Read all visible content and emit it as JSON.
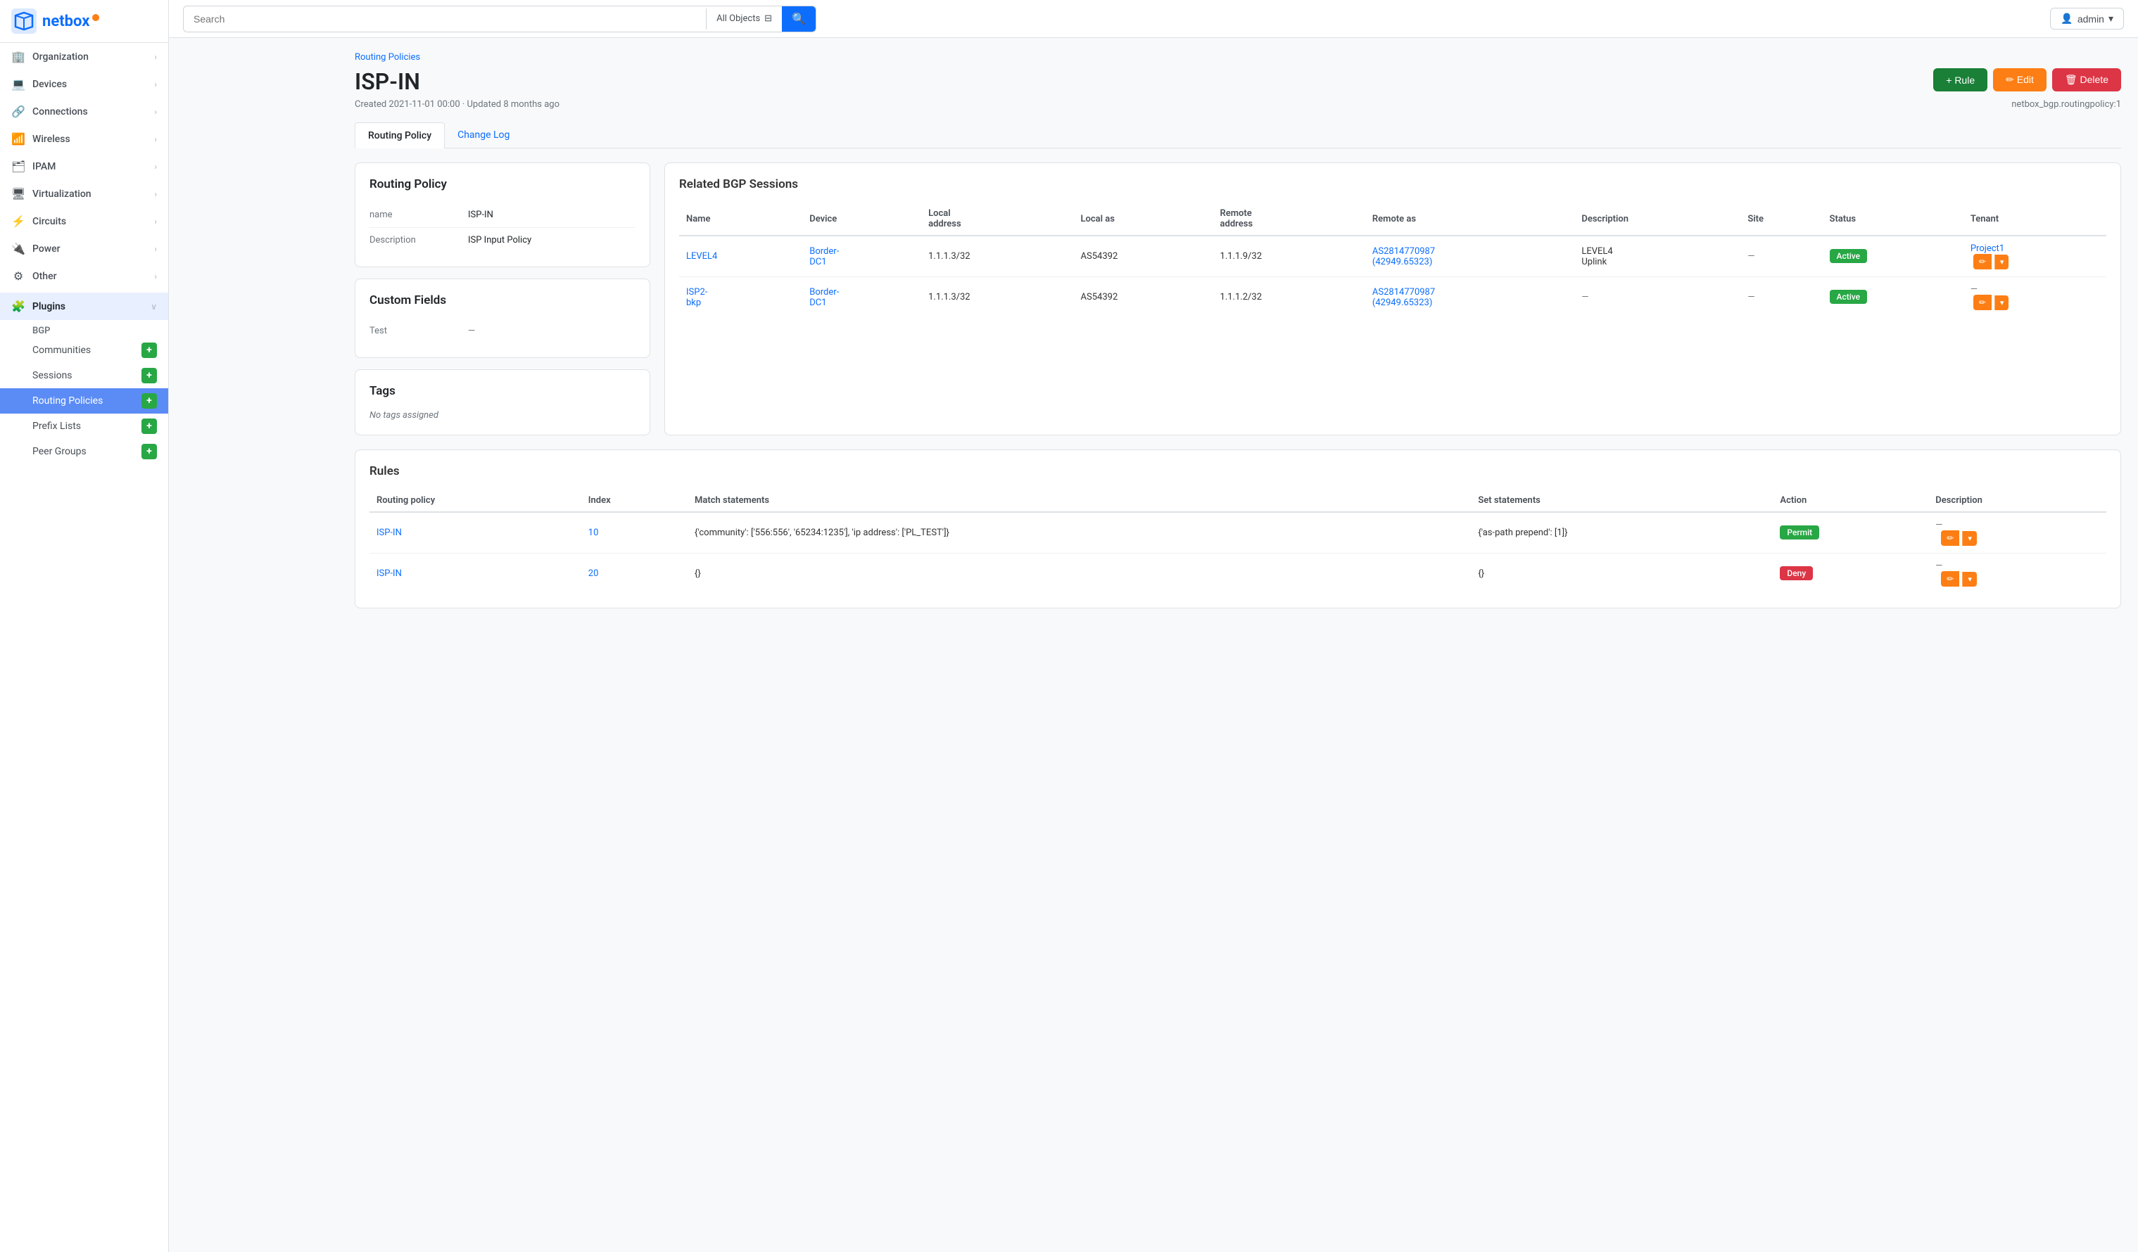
{
  "sidebar": {
    "logo_text": "netbox",
    "nav_items": [
      {
        "id": "organization",
        "label": "Organization",
        "icon": "🏢"
      },
      {
        "id": "devices",
        "label": "Devices",
        "icon": "💻"
      },
      {
        "id": "connections",
        "label": "Connections",
        "icon": "🔗"
      },
      {
        "id": "wireless",
        "label": "Wireless",
        "icon": "📶"
      },
      {
        "id": "ipam",
        "label": "IPAM",
        "icon": "🗂"
      },
      {
        "id": "virtualization",
        "label": "Virtualization",
        "icon": "🖥"
      },
      {
        "id": "circuits",
        "label": "Circuits",
        "icon": "⚡"
      },
      {
        "id": "power",
        "label": "Power",
        "icon": "🔌"
      },
      {
        "id": "other",
        "label": "Other",
        "icon": "⚙"
      }
    ],
    "plugins_label": "Plugins",
    "bgp_label": "BGP",
    "plugin_items": [
      {
        "id": "communities",
        "label": "Communities"
      },
      {
        "id": "sessions",
        "label": "Sessions"
      },
      {
        "id": "routing-policies",
        "label": "Routing Policies",
        "active": true
      },
      {
        "id": "prefix-lists",
        "label": "Prefix Lists"
      },
      {
        "id": "peer-groups",
        "label": "Peer Groups"
      }
    ]
  },
  "topbar": {
    "search_placeholder": "Search",
    "filter_label": "All Objects",
    "admin_label": "admin"
  },
  "breadcrumb": "Routing Policies",
  "page": {
    "title": "ISP-IN",
    "meta": "Created 2021-11-01 00:00 · Updated 8 months ago",
    "netbox_ref": "netbox_bgp.routingpolicy:1",
    "btn_rule": "+ Rule",
    "btn_edit": "✏ Edit",
    "btn_delete": "🗑 Delete"
  },
  "tabs": [
    {
      "id": "routing-policy",
      "label": "Routing Policy",
      "active": true
    },
    {
      "id": "change-log",
      "label": "Change Log",
      "active": false
    }
  ],
  "routing_policy_card": {
    "title": "Routing Policy",
    "fields": [
      {
        "label": "name",
        "value": "ISP-IN"
      },
      {
        "label": "Description",
        "value": "ISP Input Policy"
      }
    ]
  },
  "custom_fields_card": {
    "title": "Custom Fields",
    "fields": [
      {
        "label": "Test",
        "value": "—"
      }
    ]
  },
  "tags_card": {
    "title": "Tags",
    "no_tags": "No tags assigned"
  },
  "bgp_sessions": {
    "title": "Related BGP Sessions",
    "columns": [
      "Name",
      "Device",
      "Local address",
      "Local as",
      "Remote address",
      "Remote as",
      "Description",
      "Site",
      "Status",
      "Tenant"
    ],
    "rows": [
      {
        "name": "LEVEL4",
        "device": "Border-DC1",
        "local_address": "1.1.1.3/32",
        "local_as": "AS54392",
        "remote_address": "1.1.1.9/32",
        "remote_as": "AS2814770987 (42949.65323)",
        "description": "LEVEL4 Uplink",
        "site": "—",
        "status": "Active",
        "tenant": "Project1"
      },
      {
        "name": "ISP2-bkp",
        "device": "Border-DC1",
        "local_address": "1.1.1.3/32",
        "local_as": "AS54392",
        "remote_address": "1.1.1.2/32",
        "remote_as": "AS2814770987 (42949.65323)",
        "description": "—",
        "site": "—",
        "status": "Active",
        "tenant": "—"
      }
    ]
  },
  "rules": {
    "title": "Rules",
    "columns": [
      "Routing policy",
      "Index",
      "Match statements",
      "Set statements",
      "Action",
      "Description"
    ],
    "rows": [
      {
        "routing_policy": "ISP-IN",
        "index": "10",
        "match_statements": "{'community': ['556:556', '65234:1235'], 'ip address': ['PL_TEST']}",
        "set_statements": "{'as-path prepend': [1]}",
        "action": "Permit",
        "description": "—"
      },
      {
        "routing_policy": "ISP-IN",
        "index": "20",
        "match_statements": "{}",
        "set_statements": "{}",
        "action": "Deny",
        "description": "—"
      }
    ]
  }
}
